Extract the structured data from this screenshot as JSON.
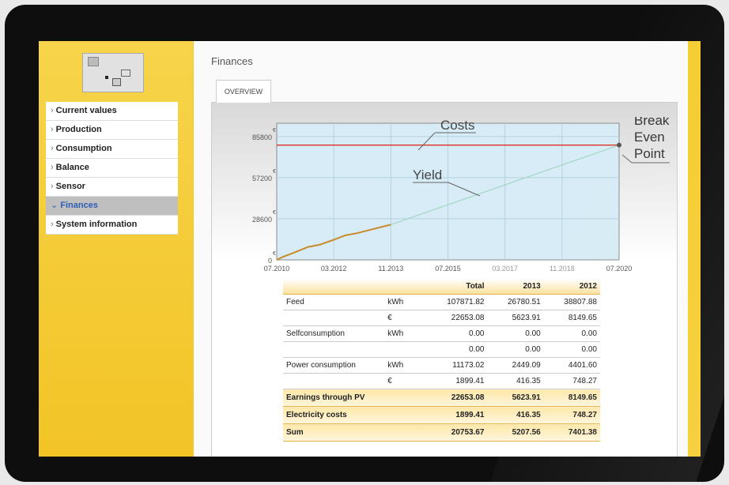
{
  "sidebar": {
    "items": [
      {
        "label": "Current values",
        "active": false
      },
      {
        "label": "Production",
        "active": false
      },
      {
        "label": "Consumption",
        "active": false
      },
      {
        "label": "Balance",
        "active": false
      },
      {
        "label": "Sensor",
        "active": false
      },
      {
        "label": "Finances",
        "active": true
      },
      {
        "label": "System information",
        "active": false
      }
    ]
  },
  "page": {
    "title": "Finances",
    "tab": "OVERVIEW"
  },
  "chart_data": {
    "type": "line",
    "y_unit": "€",
    "yticks": [
      "0",
      "28600",
      "57200",
      "85800"
    ],
    "xticks": [
      "07.2010",
      "03.2012",
      "11.2013",
      "07.2015",
      "03.2017",
      "11.2018",
      "07.2020"
    ],
    "ylim": [
      0,
      95000
    ],
    "series": [
      {
        "name": "Costs",
        "color": "#e0301e",
        "x": [
          "07.2010",
          "07.2020"
        ],
        "values": [
          79800,
          79800
        ]
      },
      {
        "name": "Yield",
        "color": "#c98a2a",
        "x": [
          "07.2010",
          "09.2010",
          "01.2011",
          "06.2011",
          "10.2011",
          "03.2012",
          "07.2012",
          "11.2012",
          "05.2013",
          "11.2013"
        ],
        "values": [
          0,
          2000,
          5000,
          9000,
          10500,
          14000,
          17000,
          18500,
          21500,
          24500
        ]
      },
      {
        "name": "",
        "color": "#a8d7c8",
        "x": [
          "11.2013",
          "07.2020"
        ],
        "values": [
          24500,
          79800
        ]
      }
    ],
    "annotations": [
      "Costs",
      "Yield",
      "Break Even Point"
    ],
    "grid": true
  },
  "table": {
    "headers": [
      "",
      "",
      "Total",
      "2013",
      "2012"
    ],
    "rows": [
      {
        "label": "Feed",
        "unit": "kWh",
        "values": [
          "107871.82",
          "26780.51",
          "38807.88"
        ]
      },
      {
        "label": "",
        "unit": "€",
        "values": [
          "22653.08",
          "5623.91",
          "8149.65"
        ]
      },
      {
        "label": "Selfconsumption",
        "unit": "kWh",
        "values": [
          "0.00",
          "0.00",
          "0.00"
        ]
      },
      {
        "label": "",
        "unit": "",
        "values": [
          "0.00",
          "0.00",
          "0.00"
        ]
      },
      {
        "label": "Power consumption",
        "unit": "kWh",
        "values": [
          "11173.02",
          "2449.09",
          "4401.60"
        ]
      },
      {
        "label": "",
        "unit": "€",
        "values": [
          "1899.41",
          "416.35",
          "748.27"
        ]
      }
    ],
    "summary": [
      {
        "label": "Earnings through PV",
        "values": [
          "22653.08",
          "5623.91",
          "8149.65"
        ]
      },
      {
        "label": "Electricity costs",
        "values": [
          "1899.41",
          "416.35",
          "748.27"
        ]
      },
      {
        "label": "Sum",
        "values": [
          "20753.67",
          "5207.56",
          "7401.38"
        ]
      }
    ]
  }
}
